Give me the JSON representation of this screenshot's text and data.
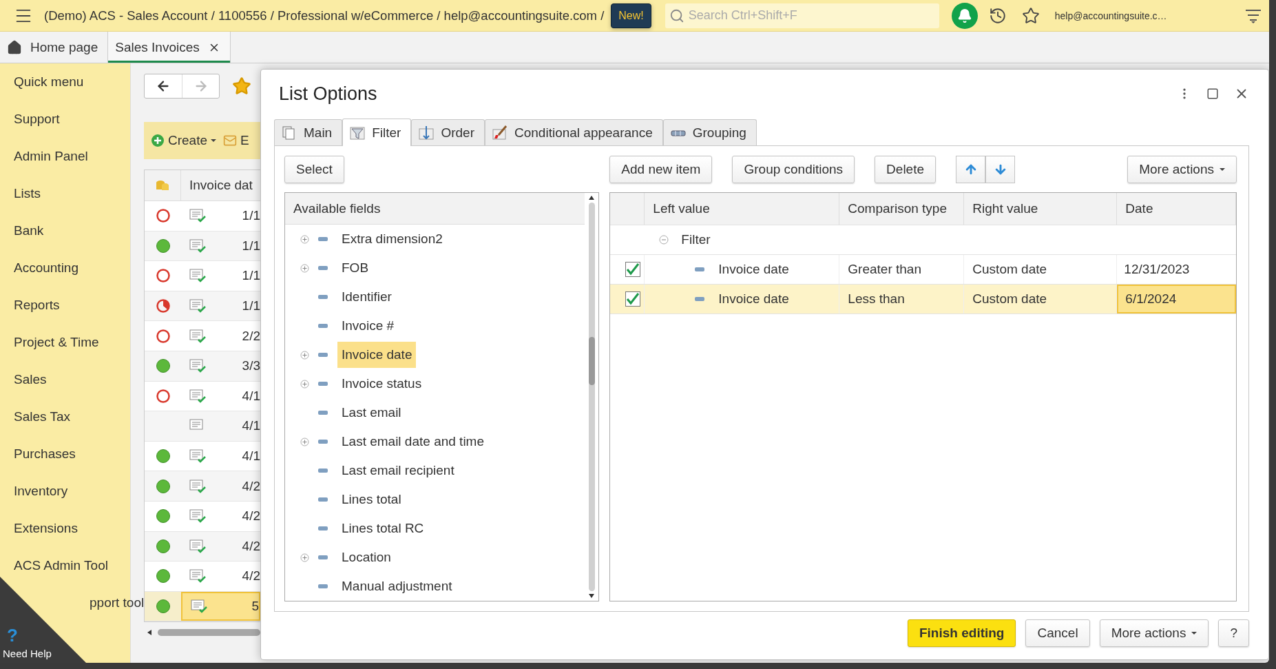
{
  "top_bar": {
    "title": "(Demo) ACS - Sales Account / 1100556 / Professional w/eCommerce / help@accountingsuite.com /",
    "badge": "New!",
    "search": {
      "placeholder": "Search Ctrl+Shift+F"
    },
    "user": "help@accountingsuite.c…"
  },
  "tabs": [
    {
      "label": "Home page",
      "kind": "home",
      "selected": false
    },
    {
      "label": "Sales Invoices",
      "kind": "closable",
      "selected": true
    }
  ],
  "sidebar": {
    "items": [
      {
        "label": "Quick menu",
        "kind": "full"
      },
      {
        "label": "Support",
        "kind": "full"
      },
      {
        "label": "Admin Panel",
        "kind": "full"
      },
      {
        "label": "Lists",
        "kind": "full"
      },
      {
        "label": "Bank",
        "kind": "full"
      },
      {
        "label": "Accounting",
        "kind": "full"
      },
      {
        "label": "Reports",
        "kind": "full"
      },
      {
        "label": "Project & Time",
        "kind": "full"
      },
      {
        "label": "Sales",
        "kind": "full"
      },
      {
        "label": "Sales Tax",
        "kind": "full"
      },
      {
        "label": "Purchases",
        "kind": "full"
      },
      {
        "label": "Inventory",
        "kind": "full"
      },
      {
        "label": "Extensions",
        "kind": "full"
      },
      {
        "label": "ACS Admin Tool",
        "kind": "full"
      },
      {
        "label": "pport tool",
        "kind": "covered"
      }
    ]
  },
  "need_help": {
    "label": "Need Help",
    "mark": "?"
  },
  "invoice_list": {
    "toolbar": {
      "create": "Create",
      "email": "E"
    },
    "columns": [
      "Invoice dat"
    ],
    "rows": [
      {
        "kind": "open",
        "posted": true,
        "date": "1/1",
        "selected": false
      },
      {
        "kind": "paid",
        "posted": true,
        "date": "1/1",
        "selected": false
      },
      {
        "kind": "open",
        "posted": true,
        "date": "1/1",
        "selected": false
      },
      {
        "kind": "partial",
        "posted": true,
        "date": "1/1",
        "selected": false
      },
      {
        "kind": "open",
        "posted": true,
        "date": "2/2",
        "selected": false
      },
      {
        "kind": "paid",
        "posted": true,
        "date": "3/3",
        "selected": false
      },
      {
        "kind": "open",
        "posted": true,
        "date": "4/1",
        "selected": false
      },
      {
        "kind": "none",
        "posted": false,
        "date": "4/1",
        "selected": false
      },
      {
        "kind": "paid",
        "posted": true,
        "date": "4/1",
        "selected": false
      },
      {
        "kind": "paid",
        "posted": true,
        "date": "4/2",
        "selected": false
      },
      {
        "kind": "paid",
        "posted": true,
        "date": "4/2",
        "selected": false
      },
      {
        "kind": "paid",
        "posted": true,
        "date": "4/2",
        "selected": false
      },
      {
        "kind": "paid",
        "posted": true,
        "date": "4/2",
        "selected": false
      },
      {
        "kind": "paid",
        "posted": true,
        "date": "5",
        "selected": true
      }
    ]
  },
  "dialog": {
    "title": "List Options",
    "tabs": [
      {
        "label": "Main",
        "kind": "main",
        "selected": false
      },
      {
        "label": "Filter",
        "kind": "filter",
        "selected": true
      },
      {
        "label": "Order",
        "kind": "order",
        "selected": false
      },
      {
        "label": "Conditional appearance",
        "kind": "appearance",
        "selected": false
      },
      {
        "label": "Grouping",
        "kind": "grouping",
        "selected": false
      }
    ],
    "select_button": "Select",
    "fields": {
      "header": "Available fields",
      "items": [
        {
          "label": "Extra dimension2",
          "expandable": true,
          "selected": false
        },
        {
          "label": "FOB",
          "expandable": true,
          "selected": false
        },
        {
          "label": "Identifier",
          "expandable": false,
          "selected": false
        },
        {
          "label": "Invoice #",
          "expandable": false,
          "selected": false
        },
        {
          "label": "Invoice date",
          "expandable": true,
          "selected": true
        },
        {
          "label": "Invoice status",
          "expandable": true,
          "selected": false
        },
        {
          "label": "Last email",
          "expandable": false,
          "selected": false
        },
        {
          "label": "Last email date and time",
          "expandable": true,
          "selected": false
        },
        {
          "label": "Last email recipient",
          "expandable": false,
          "selected": false
        },
        {
          "label": "Lines total",
          "expandable": false,
          "selected": false
        },
        {
          "label": "Lines total RC",
          "expandable": false,
          "selected": false
        },
        {
          "label": "Location",
          "expandable": true,
          "selected": false
        },
        {
          "label": "Manual adjustment",
          "expandable": false,
          "selected": false
        }
      ]
    },
    "filter": {
      "buttons": [
        "Add new item",
        "Group conditions",
        "Delete"
      ],
      "more_actions": "More actions",
      "columns": [
        "Left value",
        "Comparison type",
        "Right value",
        "Date"
      ],
      "group": {
        "label": "Filter",
        "expanded": true
      },
      "rows": [
        {
          "checked": true,
          "left": "Invoice date",
          "comparison": "Greater than",
          "right": "Custom date",
          "date": "12/31/2023",
          "selected": false
        },
        {
          "checked": true,
          "left": "Invoice date",
          "comparison": "Less than",
          "right": "Custom date",
          "date": "6/1/2024",
          "selected": true
        }
      ]
    },
    "footer_buttons": [
      {
        "label": "Finish editing",
        "kind": "primary"
      },
      {
        "label": "Cancel",
        "kind": "plain"
      },
      {
        "label": "More actions",
        "kind": "menu"
      },
      {
        "label": "?",
        "kind": "plain"
      }
    ]
  }
}
